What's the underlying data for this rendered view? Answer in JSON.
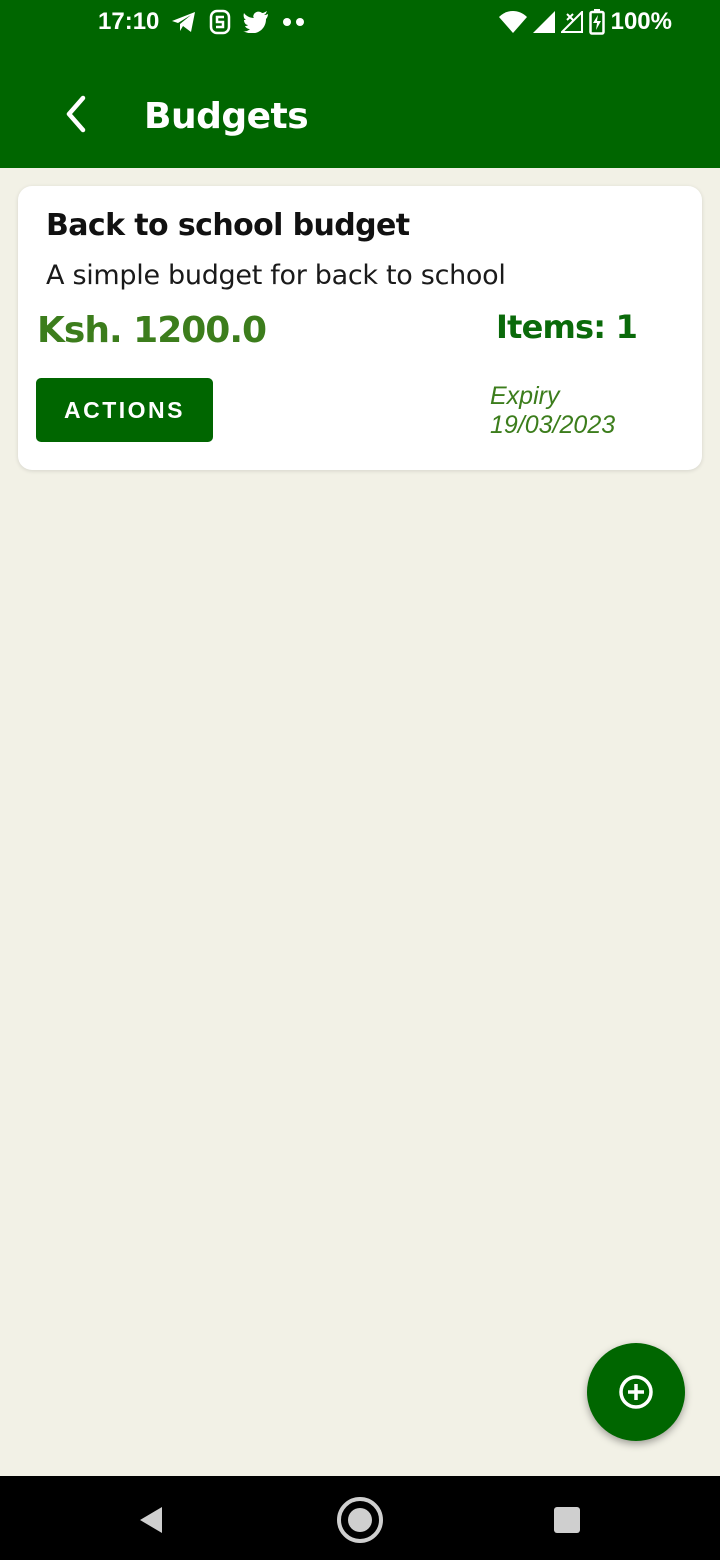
{
  "status_bar": {
    "time": "17:10",
    "notification_icons": [
      "telegram-icon",
      "s-app-icon",
      "twitter-icon",
      "more-dots-icon"
    ],
    "system_icons": [
      "wifi-icon",
      "signal-icon",
      "signal-x-icon",
      "battery-charging-icon"
    ],
    "battery": "100%"
  },
  "app_bar": {
    "title": "Budgets",
    "back_icon": "chevron-left-icon"
  },
  "budgets": [
    {
      "title": "Back to school budget",
      "description": "A simple budget for back to school",
      "amount": "Ksh. 1200.0",
      "items": "Items: 1",
      "actions_label": "ACTIONS",
      "expiry_label": "Expiry",
      "expiry_date": "19/03/2023"
    }
  ],
  "fab": {
    "icon": "add-circle-icon"
  },
  "nav_bar": {
    "icons": [
      "back-triangle-icon",
      "home-circle-icon",
      "recents-square-icon"
    ]
  },
  "colors": {
    "primary": "#006600",
    "amount_green": "#3c7d1c",
    "background": "#f2f1e6",
    "card": "#ffffff"
  }
}
